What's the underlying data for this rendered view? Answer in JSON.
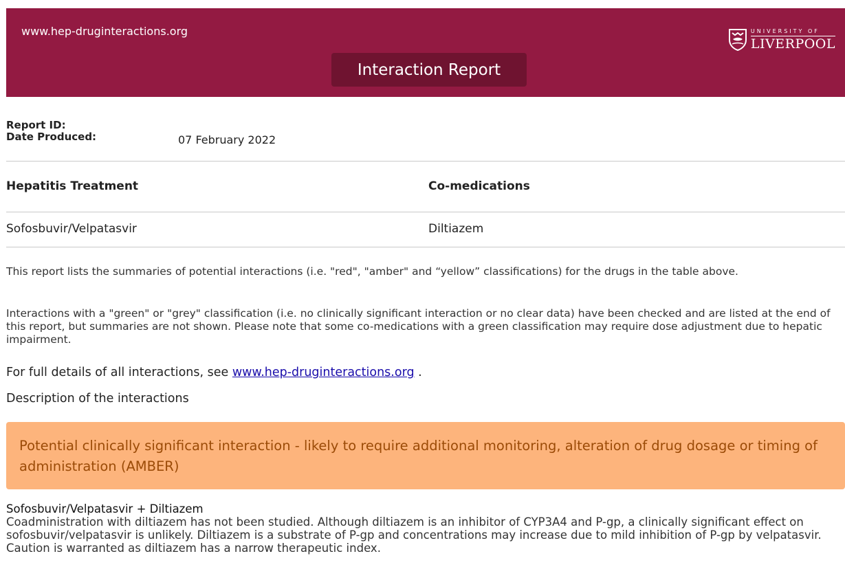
{
  "header": {
    "site_url": "www.hep-druginteractions.org",
    "title": "Interaction Report",
    "logo": {
      "top_line": "UNIVERSITY OF",
      "bottom_line": "LIVERPOOL"
    },
    "colors": {
      "banner": "#931a42",
      "title_box": "#6f1330"
    }
  },
  "meta": {
    "report_id_label": "Report ID:",
    "report_id_value": "",
    "date_label": "Date Produced:",
    "date_value": "07 February 2022"
  },
  "table": {
    "headers": [
      "Hepatitis Treatment",
      "Co-medications"
    ],
    "rows": [
      [
        "Sofosbuvir/Velpatasvir",
        "Diltiazem"
      ]
    ]
  },
  "paragraphs": {
    "p1": "This report lists the summaries of potential interactions (i.e. \"red\", \"amber\" and “yellow” classifications) for the drugs in the table above.",
    "p2": "Interactions with a \"green\" or \"grey\" classification (i.e. no clinically significant interaction or no clear data) have been checked and are listed at the end of this report, but summaries are not shown. Please note that some co-medications with a green classification may require dose adjustment due to hepatic impairment."
  },
  "full_details": {
    "prefix": "For full details of all interactions, see ",
    "link": "www.hep-druginteractions.org",
    "suffix": " ."
  },
  "description_heading": "Description of the interactions",
  "amber": {
    "text": "Potential clinically significant interaction - likely to require additional monitoring, alteration of drug dosage or timing of administration (AMBER)",
    "colors": {
      "background": "#fdb47c",
      "text": "#9b4b07"
    }
  },
  "interaction": {
    "title": "Sofosbuvir/Velpatasvir + Diltiazem",
    "body": "Coadministration with diltiazem has not been studied. Although diltiazem is an inhibitor of CYP3A4 and P-gp, a clinically significant effect on sofosbuvir/velpatasvir is unlikely. Diltiazem is a substrate of P-gp and concentrations may increase due to mild inhibition of P-gp by velpatasvir. Caution is warranted as diltiazem has a narrow therapeutic index."
  }
}
